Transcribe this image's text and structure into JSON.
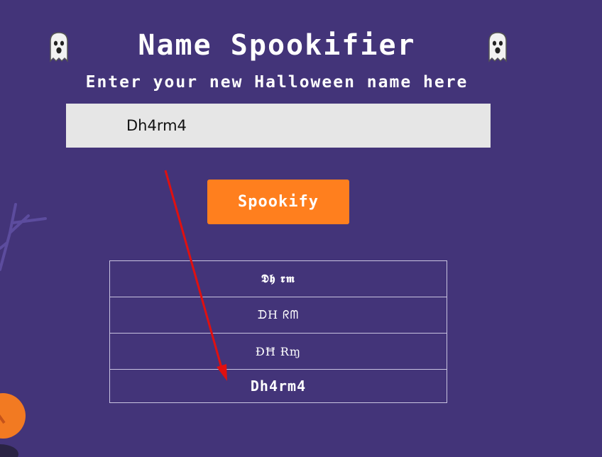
{
  "header": {
    "title": "Name Spookifier",
    "subtitle": "Enter your new Halloween name here",
    "left_icon": "ghost-icon",
    "right_icon": "ghost-icon"
  },
  "form": {
    "name_value": "Dh4rm4",
    "button_label": "Spookify"
  },
  "results": [
    "𝕯𝖍 𝖗𝖒",
    "ᗪH ᖇᗰ",
    "ĐĦ Ɍɱ",
    "Dh4rm4"
  ],
  "colors": {
    "background": "#433479",
    "button": "#ff7f1e",
    "input_background": "#e6e6e6",
    "annotation_arrow": "#e01010"
  },
  "decorations": {
    "bottom_left": "pumpkin-icon",
    "left_edge": "bare-tree-branch-icon"
  }
}
